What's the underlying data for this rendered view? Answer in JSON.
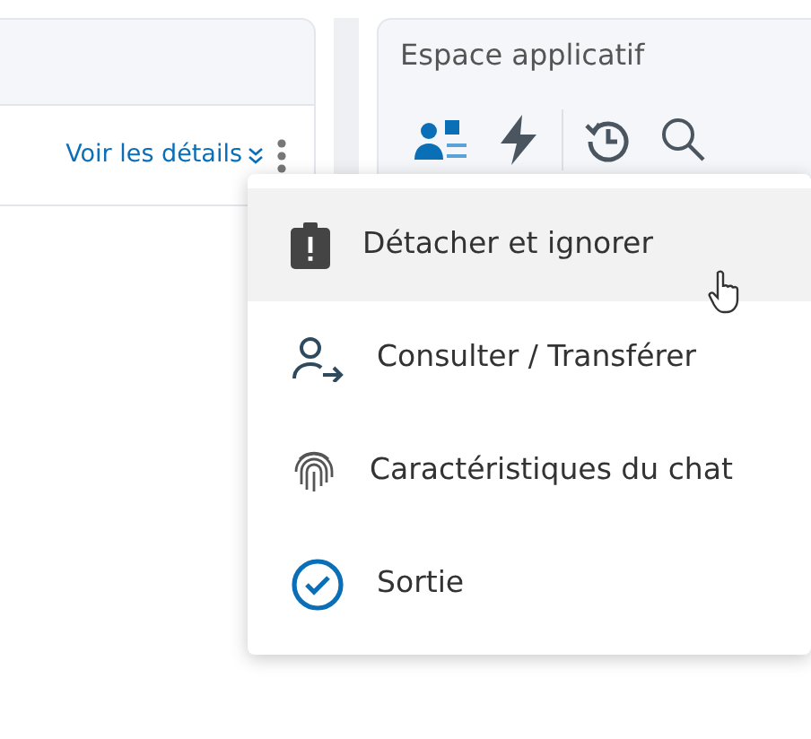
{
  "left_panel": {
    "details_link": "Voir les détails"
  },
  "app_panel": {
    "title": "Espace applicatif",
    "tools": [
      {
        "selected": true
      },
      {
        "selected": false
      },
      {
        "selected": false
      },
      {
        "selected": false
      }
    ]
  },
  "menu": {
    "items": [
      {
        "label": "Détacher et ignorer",
        "hovered": true
      },
      {
        "label": "Consulter / Transférer",
        "hovered": false
      },
      {
        "label": "Caractéristiques du chat",
        "hovered": false
      },
      {
        "label": "Sortie",
        "hovered": false
      }
    ]
  }
}
